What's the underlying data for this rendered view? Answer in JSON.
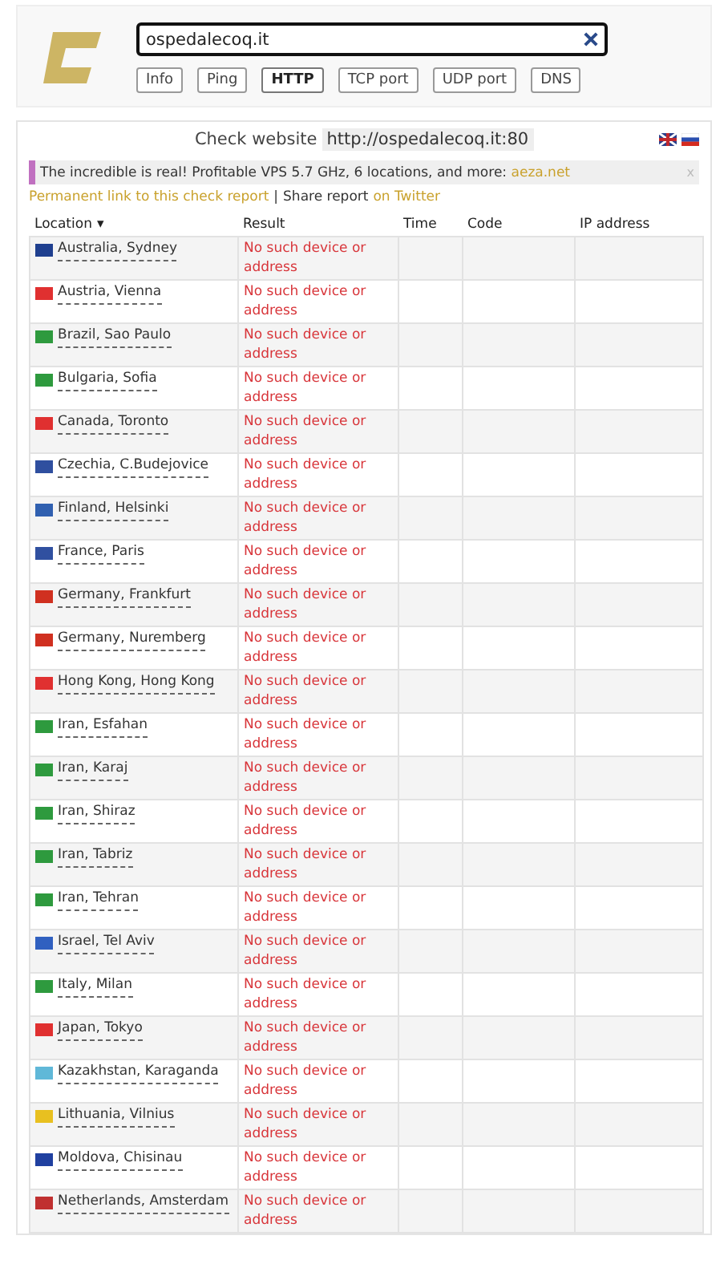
{
  "search": {
    "value": "ospedalecoq.it"
  },
  "tabs": [
    {
      "label": "Info",
      "selected": false
    },
    {
      "label": "Ping",
      "selected": false
    },
    {
      "label": "HTTP",
      "selected": true
    },
    {
      "label": "TCP port",
      "selected": false
    },
    {
      "label": "UDP port",
      "selected": false
    },
    {
      "label": "DNS",
      "selected": false
    }
  ],
  "check": {
    "title": "Check website",
    "url": "http://ospedalecoq.it:80"
  },
  "ad": {
    "text": "The incredible is real! Profitable VPS 5.7 GHz, 6 locations, and more: ",
    "link": "aeza.net",
    "close": "x"
  },
  "links": {
    "permanent": "Permanent link to this check report",
    "separator": "|",
    "share": "Share report",
    "twitter": "on Twitter"
  },
  "table": {
    "columns": [
      "Location",
      "Result",
      "Time",
      "Code",
      "IP address"
    ],
    "sort_indicator": "▾",
    "rows": [
      {
        "location": "Australia, Sydney",
        "result": "No such device or address",
        "color": "#1f3f8f"
      },
      {
        "location": "Austria, Vienna",
        "result": "No such device or address",
        "color": "#e03030"
      },
      {
        "location": "Brazil, Sao Paulo",
        "result": "No such device or address",
        "color": "#2e9a3e"
      },
      {
        "location": "Bulgaria, Sofia",
        "result": "No such device or address",
        "color": "#2e9a3e"
      },
      {
        "location": "Canada, Toronto",
        "result": "No such device or address",
        "color": "#e03030"
      },
      {
        "location": "Czechia, C.Budejovice",
        "result": "No such device or address",
        "color": "#2f4f9f"
      },
      {
        "location": "Finland, Helsinki",
        "result": "No such device or address",
        "color": "#3060b0"
      },
      {
        "location": "France, Paris",
        "result": "No such device or address",
        "color": "#3050a0"
      },
      {
        "location": "Germany, Frankfurt",
        "result": "No such device or address",
        "color": "#d03020"
      },
      {
        "location": "Germany, Nuremberg",
        "result": "No such device or address",
        "color": "#d03020"
      },
      {
        "location": "Hong Kong, Hong Kong",
        "result": "No such device or address",
        "color": "#e03030"
      },
      {
        "location": "Iran, Esfahan",
        "result": "No such device or address",
        "color": "#2e9a3e"
      },
      {
        "location": "Iran, Karaj",
        "result": "No such device or address",
        "color": "#2e9a3e"
      },
      {
        "location": "Iran, Shiraz",
        "result": "No such device or address",
        "color": "#2e9a3e"
      },
      {
        "location": "Iran, Tabriz",
        "result": "No such device or address",
        "color": "#2e9a3e"
      },
      {
        "location": "Iran, Tehran",
        "result": "No such device or address",
        "color": "#2e9a3e"
      },
      {
        "location": "Israel, Tel Aviv",
        "result": "No such device or address",
        "color": "#3060c0"
      },
      {
        "location": "Italy, Milan",
        "result": "No such device or address",
        "color": "#2e9a3e"
      },
      {
        "location": "Japan, Tokyo",
        "result": "No such device or address",
        "color": "#e03030"
      },
      {
        "location": "Kazakhstan, Karaganda",
        "result": "No such device or address",
        "color": "#60b8d8"
      },
      {
        "location": "Lithuania, Vilnius",
        "result": "No such device or address",
        "color": "#e8c020"
      },
      {
        "location": "Moldova, Chisinau",
        "result": "No such device or address",
        "color": "#2040a0"
      },
      {
        "location": "Netherlands, Amsterdam",
        "result": "No such device or address",
        "color": "#c03030"
      }
    ]
  }
}
